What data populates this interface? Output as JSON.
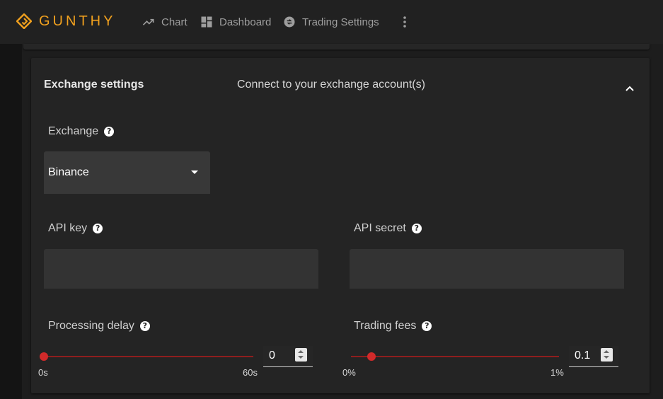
{
  "brand": {
    "name": "GUNTHY",
    "accent": "#f0a01e"
  },
  "nav": {
    "items": [
      {
        "label": "Chart",
        "icon": "trending-up-icon"
      },
      {
        "label": "Dashboard",
        "icon": "dashboard-icon"
      },
      {
        "label": "Trading Settings",
        "icon": "exchange-icon"
      }
    ],
    "more_icon": "more-vert-icon"
  },
  "panel": {
    "title": "Exchange settings",
    "subtitle": "Connect to your exchange account(s)",
    "expanded": true
  },
  "fields": {
    "exchange": {
      "label": "Exchange",
      "value": "Binance"
    },
    "api_key": {
      "label": "API key",
      "value": ""
    },
    "api_secret": {
      "label": "API secret",
      "value": ""
    },
    "processing_delay": {
      "label": "Processing delay",
      "value": "0",
      "min_label": "0s",
      "max_label": "60s",
      "fraction": 0
    },
    "trading_fees": {
      "label": "Trading fees",
      "value": "0.1",
      "min_label": "0%",
      "max_label": "1%",
      "fraction": 0.1
    }
  },
  "colors": {
    "slider": "#d12a2a",
    "slider_track": "#8f1e1e"
  }
}
